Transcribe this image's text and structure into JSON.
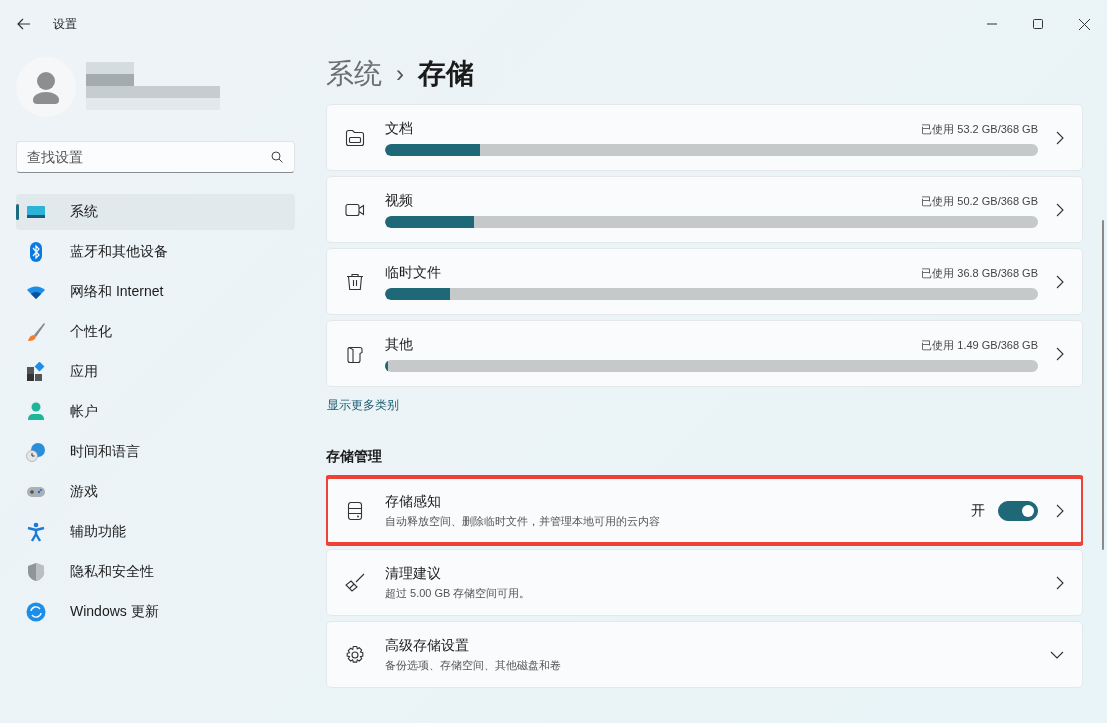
{
  "window": {
    "title": "设置"
  },
  "account": {
    "name_redacted": true
  },
  "search": {
    "placeholder": "查找设置"
  },
  "sidebar": {
    "items": [
      {
        "label": "系统",
        "selected": true
      },
      {
        "label": "蓝牙和其他设备",
        "selected": false
      },
      {
        "label": "网络和 Internet",
        "selected": false
      },
      {
        "label": "个性化",
        "selected": false
      },
      {
        "label": "应用",
        "selected": false
      },
      {
        "label": "帐户",
        "selected": false
      },
      {
        "label": "时间和语言",
        "selected": false
      },
      {
        "label": "游戏",
        "selected": false
      },
      {
        "label": "辅助功能",
        "selected": false
      },
      {
        "label": "隐私和安全性",
        "selected": false
      },
      {
        "label": "Windows 更新",
        "selected": false
      }
    ]
  },
  "breadcrumb": {
    "parent": "系统",
    "separator": "›",
    "current": "存储"
  },
  "categories": [
    {
      "name": "文档",
      "usage": "已使用 53.2 GB/368 GB",
      "level": 0.145
    },
    {
      "name": "视频",
      "usage": "已使用 50.2 GB/368 GB",
      "level": 0.137
    },
    {
      "name": "临时文件",
      "usage": "已使用 36.8 GB/368 GB",
      "level": 0.1
    },
    {
      "name": "其他",
      "usage": "已使用 1.49 GB/368 GB",
      "level": 0.005
    }
  ],
  "show_more_link": "显示更多类别",
  "management": {
    "heading": "存储管理",
    "items": [
      {
        "kind": "toggle",
        "title": "存储感知",
        "description": "自动释放空间、删除临时文件，并管理本地可用的云内容",
        "state_label": "开",
        "on": true,
        "highlighted": true
      },
      {
        "kind": "link",
        "title": "清理建议",
        "description": "超过 5.00 GB 存储空间可用。",
        "highlighted": false
      },
      {
        "kind": "expand",
        "title": "高级存储设置",
        "description": "备份选项、存储空间、其他磁盘和卷",
        "highlighted": false
      }
    ]
  }
}
